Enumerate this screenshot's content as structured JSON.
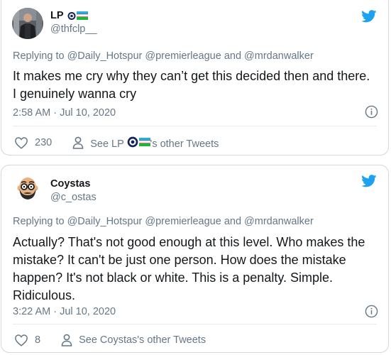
{
  "tweets": [
    {
      "display_name": "LP",
      "handle": "@thfclp__",
      "reply_prefix": "Replying to",
      "reply_mentions": "@Daily_Hotspur @premierleague and @mrdanwalker",
      "text": "It makes me cry why they can’t get this decided then and there. I genuinely wanna cry",
      "timestamp": "2:58 AM · Jul 10, 2020",
      "likes": "230",
      "profile_link_prefix": "See LP",
      "profile_link_suffix": "'s other Tweets",
      "avatar_icon": "profile-photo-dark-jacket",
      "name_emoji": [
        "tottenham-crest-icon",
        "uzbekistan-flag-icon"
      ]
    },
    {
      "display_name": "Coystas",
      "handle": "@c_ostas",
      "reply_prefix": "Replying to",
      "reply_mentions": "@Daily_Hotspur @premierleague and @mrdanwalker",
      "text": "Actually? That's not good enough at this level. Who makes the mistake? It can't be just one person. How does the mistake happen? It's not black or white. This is a penalty. Simple. Ridiculous.",
      "timestamp": "3:22 AM · Jul 10, 2020",
      "likes": "8",
      "profile_link": "See Coystas's other Tweets",
      "avatar_icon": "cartoon-bald-bearded-man-with-glasses"
    }
  ],
  "colors": {
    "twitter_blue": "#1DA1F2",
    "link_blue": "#1B95E0",
    "secondary_text": "#657786",
    "border": "#CFD9DE"
  }
}
